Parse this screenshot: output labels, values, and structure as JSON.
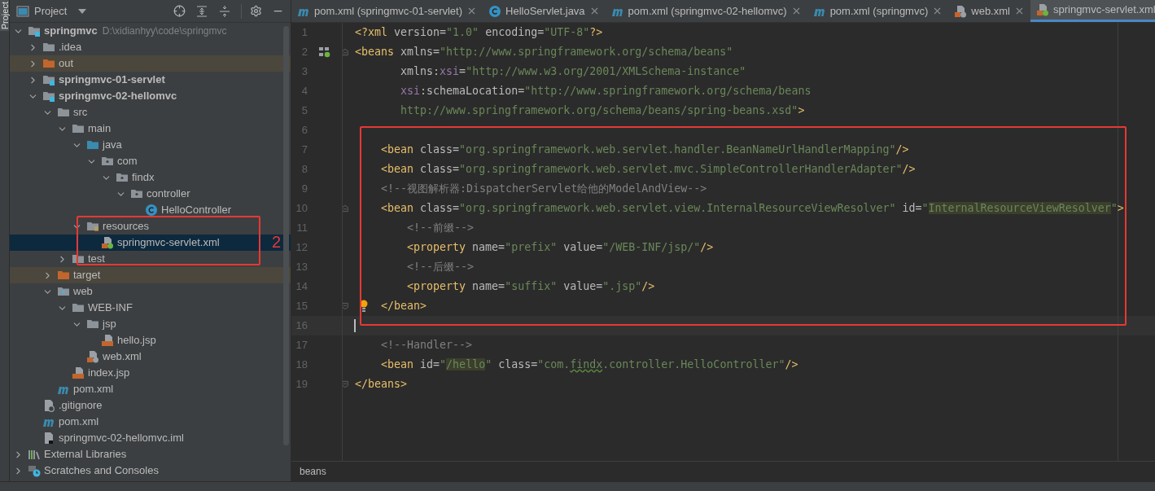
{
  "side_tab": {
    "label": "Project"
  },
  "project_panel": {
    "title": "Project",
    "tree": [
      {
        "label": "springmvc",
        "kind": "module",
        "bold": true,
        "path": "D:\\xidianhyy\\code\\springmvc",
        "expanded": true,
        "selected": false,
        "children": [
          {
            "label": ".idea",
            "kind": "folder",
            "expanded": false,
            "selected": false
          },
          {
            "label": "out",
            "kind": "excluded",
            "expanded": false,
            "selected": false
          },
          {
            "label": "springmvc-01-servlet",
            "kind": "module",
            "bold": true,
            "expanded": false,
            "selected": false
          },
          {
            "label": "springmvc-02-hellomvc",
            "kind": "module",
            "bold": true,
            "expanded": true,
            "selected": false,
            "children": [
              {
                "label": "src",
                "kind": "folder",
                "expanded": true,
                "selected": false,
                "children": [
                  {
                    "label": "main",
                    "kind": "folder",
                    "expanded": true,
                    "selected": false,
                    "children": [
                      {
                        "label": "java",
                        "kind": "source",
                        "expanded": true,
                        "selected": false,
                        "children": [
                          {
                            "label": "com",
                            "kind": "package",
                            "expanded": true,
                            "selected": false,
                            "children": [
                              {
                                "label": "findx",
                                "kind": "package",
                                "expanded": true,
                                "selected": false,
                                "children": [
                                  {
                                    "label": "controller",
                                    "kind": "package",
                                    "expanded": true,
                                    "selected": false,
                                    "children": [
                                      {
                                        "label": "HelloController",
                                        "kind": "class",
                                        "selected": false
                                      }
                                    ]
                                  }
                                ]
                              }
                            ]
                          }
                        ]
                      },
                      {
                        "label": "resources",
                        "kind": "resources",
                        "expanded": true,
                        "selected": false,
                        "children": [
                          {
                            "label": "springmvc-servlet.xml",
                            "kind": "spring-xml",
                            "selected": true
                          }
                        ]
                      }
                    ]
                  },
                  {
                    "label": "test",
                    "kind": "folder",
                    "expanded": false,
                    "selected": false
                  }
                ]
              },
              {
                "label": "target",
                "kind": "excluded",
                "expanded": false,
                "selected": false
              },
              {
                "label": "web",
                "kind": "web",
                "expanded": true,
                "selected": false,
                "children": [
                  {
                    "label": "WEB-INF",
                    "kind": "folder",
                    "expanded": true,
                    "selected": false,
                    "children": [
                      {
                        "label": "jsp",
                        "kind": "folder",
                        "expanded": true,
                        "selected": false,
                        "children": [
                          {
                            "label": "hello.jsp",
                            "kind": "jsp",
                            "selected": false
                          }
                        ]
                      },
                      {
                        "label": "web.xml",
                        "kind": "web-xml",
                        "selected": false
                      }
                    ]
                  },
                  {
                    "label": "index.jsp",
                    "kind": "jsp",
                    "selected": false
                  }
                ]
              },
              {
                "label": "pom.xml",
                "kind": "maven",
                "selected": false
              }
            ]
          },
          {
            "label": ".gitignore",
            "kind": "ignore",
            "selected": false
          },
          {
            "label": "pom.xml",
            "kind": "maven",
            "selected": false
          },
          {
            "label": "springmvc-02-hellomvc.iml",
            "kind": "iml",
            "selected": false
          }
        ]
      },
      {
        "label": "External Libraries",
        "kind": "libraries",
        "expanded": false,
        "selected": false
      },
      {
        "label": "Scratches and Consoles",
        "kind": "scratches",
        "expanded": false,
        "selected": false
      }
    ],
    "annotation": {
      "label": "2"
    }
  },
  "tabs": [
    {
      "label": "pom.xml (springmvc-01-servlet)",
      "kind": "maven",
      "selected": false
    },
    {
      "label": "HelloServlet.java",
      "kind": "class",
      "selected": false
    },
    {
      "label": "pom.xml (springmvc-02-hellomvc)",
      "kind": "maven",
      "selected": false
    },
    {
      "label": "pom.xml (springmvc)",
      "kind": "maven",
      "selected": false
    },
    {
      "label": "web.xml",
      "kind": "web-xml",
      "selected": false
    },
    {
      "label": "springmvc-servlet.xml",
      "kind": "spring-xml",
      "selected": true
    }
  ],
  "editor": {
    "lines": [
      {
        "number": "1",
        "current": false,
        "tokens": [
          {
            "kind": "tag",
            "text": "<?xml"
          },
          {
            "kind": "attr",
            "text": " version="
          },
          {
            "kind": "str",
            "text": "\"1.0\""
          },
          {
            "kind": "attr",
            "text": " encoding="
          },
          {
            "kind": "str",
            "text": "\"UTF-8\""
          },
          {
            "kind": "tag",
            "text": "?>"
          }
        ]
      },
      {
        "number": "2",
        "current": false,
        "fold_open": true,
        "gutter_icon": true,
        "tokens": [
          {
            "kind": "tag",
            "text": "<beans"
          },
          {
            "kind": "attr",
            "text": " xmlns="
          },
          {
            "kind": "str",
            "text": "\"http://www.springframework.org/schema/beans\""
          }
        ]
      },
      {
        "number": "3",
        "current": false,
        "tokens": [
          {
            "kind": "attr",
            "text": "       xmlns:"
          },
          {
            "kind": "ns",
            "text": "xsi"
          },
          {
            "kind": "attr",
            "text": "="
          },
          {
            "kind": "str",
            "text": "\"http://www.w3.org/2001/XMLSchema-instance\""
          }
        ]
      },
      {
        "number": "4",
        "current": false,
        "tokens": [
          {
            "kind": "ns",
            "text": "       xsi"
          },
          {
            "kind": "attr",
            "text": ":schemaLocation="
          },
          {
            "kind": "str",
            "text": "\"http://www.springframework.org/schema/beans"
          }
        ]
      },
      {
        "number": "5",
        "current": false,
        "tokens": [
          {
            "kind": "str",
            "text": "       http://www.springframework.org/schema/beans/spring-beans.xsd\""
          },
          {
            "kind": "tag",
            "text": ">"
          }
        ]
      },
      {
        "number": "6",
        "current": false
      },
      {
        "number": "7",
        "current": false,
        "tokens": [
          {
            "kind": "tag",
            "text": "    <bean"
          },
          {
            "kind": "attr",
            "text": " class="
          },
          {
            "kind": "str",
            "text": "\"org.springframework.web.servlet.handler.BeanNameUrlHandlerMapping\""
          },
          {
            "kind": "tag",
            "text": "/>"
          }
        ]
      },
      {
        "number": "8",
        "current": false,
        "tokens": [
          {
            "kind": "tag",
            "text": "    <bean"
          },
          {
            "kind": "attr",
            "text": " class="
          },
          {
            "kind": "str",
            "text": "\"org.springframework.web.servlet.mvc.SimpleControllerHandlerAdapter\""
          },
          {
            "kind": "tag",
            "text": "/>"
          }
        ]
      },
      {
        "number": "9",
        "current": false,
        "tokens": [
          {
            "kind": "comment",
            "text": "    <!--视图解析器:DispatcherServlet给他的ModelAndView-->"
          }
        ]
      },
      {
        "number": "10",
        "current": false,
        "fold_open": true,
        "tokens": [
          {
            "kind": "tag",
            "text": "    <bean"
          },
          {
            "kind": "attr",
            "text": " class="
          },
          {
            "kind": "str",
            "text": "\"org.springframework.web.servlet.view.InternalResourceViewResolver\""
          },
          {
            "kind": "attr",
            "text": " id="
          },
          {
            "kind": "str",
            "text": "\""
          },
          {
            "kind": "hl",
            "text": "InternalResourceViewResolver"
          },
          {
            "kind": "str",
            "text": "\""
          },
          {
            "kind": "tag",
            "text": ">"
          }
        ]
      },
      {
        "number": "11",
        "current": false,
        "tokens": [
          {
            "kind": "comment",
            "text": "        <!--前缀-->"
          }
        ]
      },
      {
        "number": "12",
        "current": false,
        "tokens": [
          {
            "kind": "tag",
            "text": "        <property"
          },
          {
            "kind": "attr",
            "text": " name="
          },
          {
            "kind": "str",
            "text": "\"prefix\""
          },
          {
            "kind": "attr",
            "text": " value="
          },
          {
            "kind": "str",
            "text": "\"/WEB-INF/jsp/\""
          },
          {
            "kind": "tag",
            "text": "/>"
          }
        ]
      },
      {
        "number": "13",
        "current": false,
        "tokens": [
          {
            "kind": "comment",
            "text": "        <!--后缀-->"
          }
        ]
      },
      {
        "number": "14",
        "current": false,
        "tokens": [
          {
            "kind": "tag",
            "text": "        <property"
          },
          {
            "kind": "attr",
            "text": " name="
          },
          {
            "kind": "str",
            "text": "\"suffix\""
          },
          {
            "kind": "attr",
            "text": " value="
          },
          {
            "kind": "str",
            "text": "\".jsp\""
          },
          {
            "kind": "tag",
            "text": "/>"
          }
        ]
      },
      {
        "number": "15",
        "current": false,
        "fold_close": true,
        "bulb": true,
        "tokens": [
          {
            "kind": "tag",
            "text": "</bean>"
          }
        ]
      },
      {
        "number": "16",
        "current": true
      },
      {
        "number": "17",
        "current": false,
        "tokens": [
          {
            "kind": "comment",
            "text": "    <!--Handler-->"
          }
        ]
      },
      {
        "number": "18",
        "current": false,
        "tokens": [
          {
            "kind": "tag",
            "text": "    <bean"
          },
          {
            "kind": "attr",
            "text": " id="
          },
          {
            "kind": "str",
            "text": "\""
          },
          {
            "kind": "hl",
            "text": "/hello"
          },
          {
            "kind": "str",
            "text": "\""
          },
          {
            "kind": "attr",
            "text": " class="
          },
          {
            "kind": "str",
            "text": "\"com."
          },
          {
            "kind": "typo",
            "text": "findx"
          },
          {
            "kind": "str",
            "text": ".controller.HelloController\""
          },
          {
            "kind": "tag",
            "text": "/>"
          }
        ]
      },
      {
        "number": "19",
        "current": false,
        "fold_close": true,
        "tokens": [
          {
            "kind": "tag",
            "text": "</beans>"
          }
        ]
      }
    ]
  },
  "breadcrumb": [
    "beans"
  ]
}
